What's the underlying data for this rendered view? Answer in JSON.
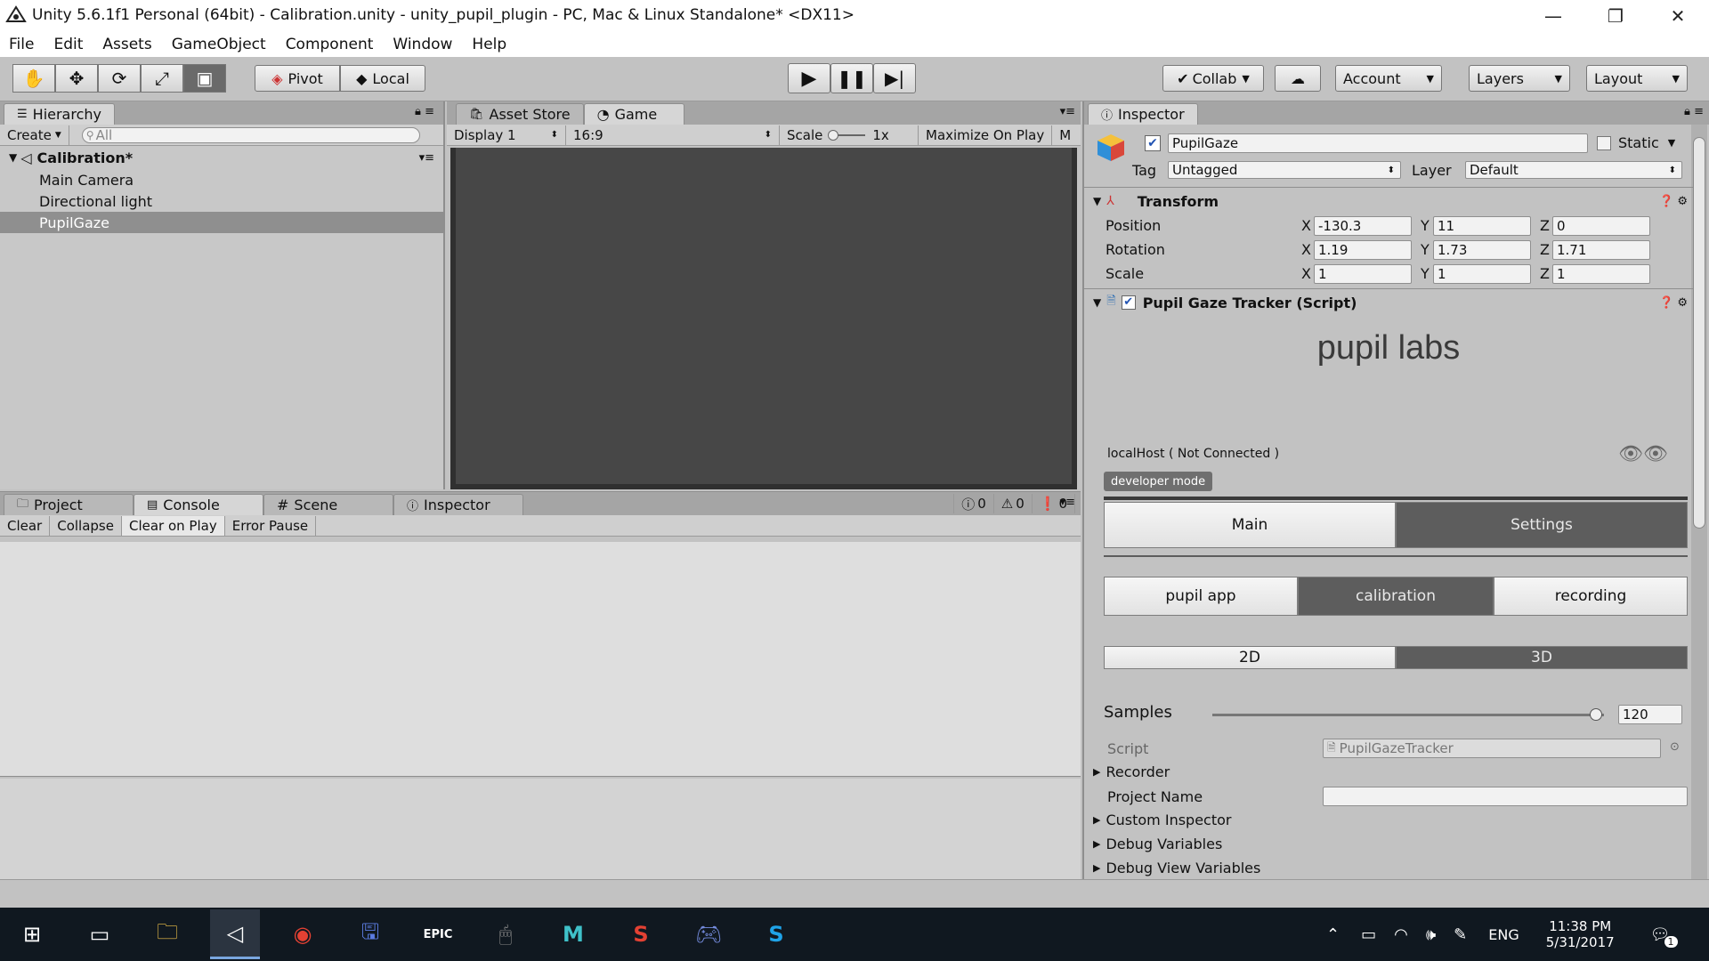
{
  "window": {
    "title": "Unity 5.6.1f1 Personal (64bit) - Calibration.unity - unity_pupil_plugin - PC, Mac & Linux Standalone* <DX11>",
    "controls": [
      "—",
      "❐",
      "✕"
    ]
  },
  "menu": [
    "File",
    "Edit",
    "Assets",
    "GameObject",
    "Component",
    "Window",
    "Help"
  ],
  "toolbar": {
    "pivot": "Pivot",
    "local": "Local",
    "collab": "Collab",
    "account": "Account",
    "layers": "Layers",
    "layout": "Layout"
  },
  "hierarchy": {
    "tab": "Hierarchy",
    "create": "Create",
    "search_placeholder": "All",
    "scene": "Calibration*",
    "items": [
      "Main Camera",
      "Directional light",
      "PupilGaze"
    ]
  },
  "game": {
    "tabs": [
      "Asset Store",
      "Game"
    ],
    "display": "Display 1",
    "aspect": "16:9",
    "scale_label": "Scale",
    "scale_value": "1x",
    "maximize": "Maximize On Play",
    "more": "M"
  },
  "console": {
    "tabs": [
      "Project",
      "Console",
      "Scene",
      "Inspector"
    ],
    "buttons": [
      "Clear",
      "Collapse",
      "Clear on Play",
      "Error Pause"
    ],
    "counts": [
      "0",
      "0",
      "0"
    ]
  },
  "inspector": {
    "tab": "Inspector",
    "object_name": "PupilGaze",
    "static_label": "Static",
    "tag_label": "Tag",
    "tag_value": "Untagged",
    "layer_label": "Layer",
    "layer_value": "Default",
    "transform": {
      "title": "Transform",
      "rows": [
        {
          "label": "Position",
          "x": "-130.3",
          "y": "11",
          "z": "0"
        },
        {
          "label": "Rotation",
          "x": "1.19",
          "y": "1.73",
          "z": "1.71"
        },
        {
          "label": "Scale",
          "x": "1",
          "y": "1",
          "z": "1"
        }
      ],
      "axis": [
        "X",
        "Y",
        "Z"
      ]
    },
    "script_component": {
      "title": "Pupil Gaze Tracker (Script)",
      "brand": "pupil labs",
      "connection": "localHost ( Not Connected )",
      "dev_mode": "developer mode",
      "main_tabs": [
        "Main",
        "Settings"
      ],
      "sub_tabs": [
        "pupil app",
        "calibration",
        "recording"
      ],
      "mode_tabs": [
        "2D",
        "3D"
      ],
      "samples_label": "Samples",
      "samples_value": "120",
      "samples_fraction": 0.98,
      "script_label": "Script",
      "script_value": "PupilGazeTracker",
      "recorder": "Recorder",
      "project_name": "Project Name",
      "custom_inspector": "Custom Inspector",
      "debug_variables": "Debug Variables",
      "debug_view_variables": "Debug View Variables"
    }
  },
  "taskbar": {
    "lang": "ENG",
    "time": "11:38 PM",
    "date": "5/31/2017",
    "notification_count": "1"
  },
  "colors": {
    "panel": "#c2c2c2",
    "game_view": "#474747",
    "seg_dark": "#5d5d5d",
    "taskbar": "#101820"
  }
}
